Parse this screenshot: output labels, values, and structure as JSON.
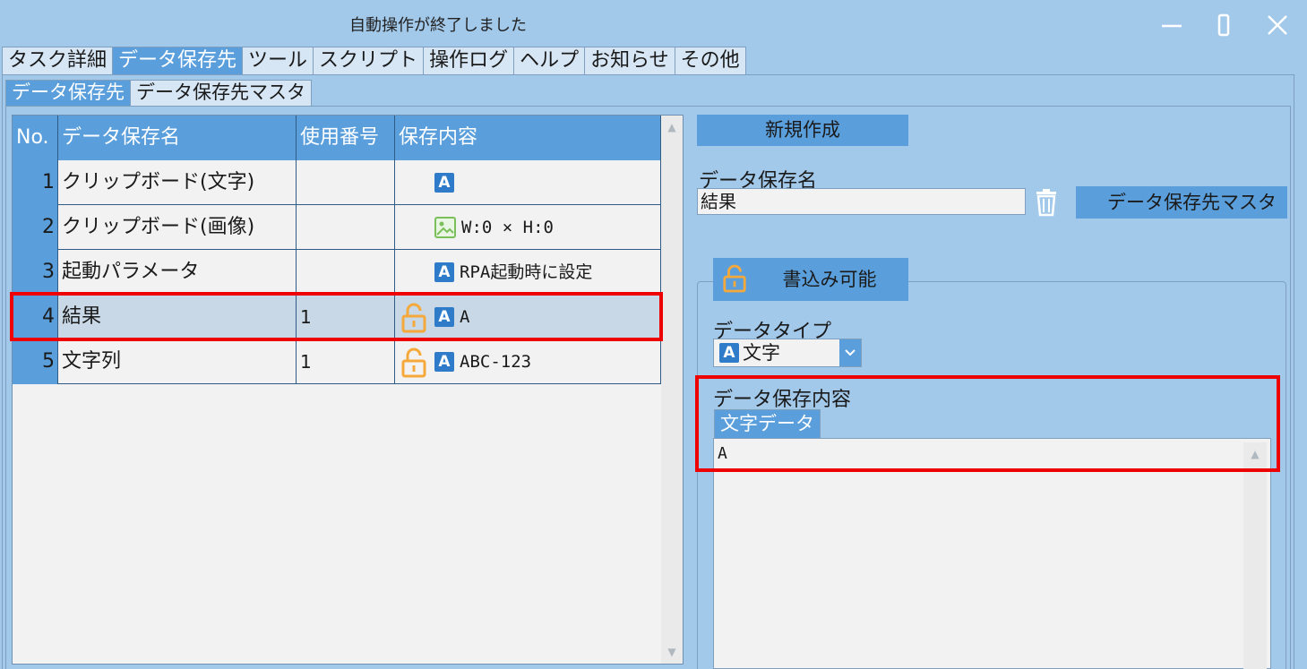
{
  "window": {
    "title": "自動操作が終了しました"
  },
  "main_tabs": [
    {
      "label": "タスク詳細",
      "active": false
    },
    {
      "label": "データ保存先",
      "active": true
    },
    {
      "label": "ツール",
      "active": false
    },
    {
      "label": "スクリプト",
      "active": false
    },
    {
      "label": "操作ログ",
      "active": false
    },
    {
      "label": "ヘルプ",
      "active": false
    },
    {
      "label": "お知らせ",
      "active": false
    },
    {
      "label": "その他",
      "active": false
    }
  ],
  "sub_tabs": [
    {
      "label": "データ保存先",
      "active": true
    },
    {
      "label": "データ保存先マスタ",
      "active": false
    }
  ],
  "grid": {
    "headers": {
      "no": "No.",
      "name": "データ保存名",
      "num": "使用番号",
      "content": "保存内容"
    },
    "rows": [
      {
        "no": "1",
        "name": "クリップボード(文字)",
        "num": "",
        "icon": "text-type-icon",
        "lock": false,
        "content": ""
      },
      {
        "no": "2",
        "name": "クリップボード(画像)",
        "num": "",
        "icon": "image-type-icon",
        "lock": false,
        "content": "W:0 × H:0"
      },
      {
        "no": "3",
        "name": "起動パラメータ",
        "num": "",
        "icon": "text-type-icon",
        "lock": false,
        "content": "RPA起動時に設定"
      },
      {
        "no": "4",
        "name": "結果",
        "num": "1",
        "icon": "text-type-icon",
        "lock": true,
        "content": "A",
        "selected": true
      },
      {
        "no": "5",
        "name": "文字列",
        "num": "1",
        "icon": "text-type-icon",
        "lock": true,
        "content": "ABC-123"
      }
    ]
  },
  "detail": {
    "new_button": "新規作成",
    "name_label": "データ保存名",
    "name_value": "結果",
    "master_button": "データ保存先マスタ",
    "writable_button": "書込み可能",
    "type_label": "データタイプ",
    "type_value": "文字",
    "content_label": "データ保存内容",
    "content_tab": "文字データ",
    "content_value": "A"
  },
  "colors": {
    "background": "#a2c8ea",
    "accent": "#5a9fdc",
    "lock": "#f5a93a",
    "highlight": "#ee0000"
  }
}
